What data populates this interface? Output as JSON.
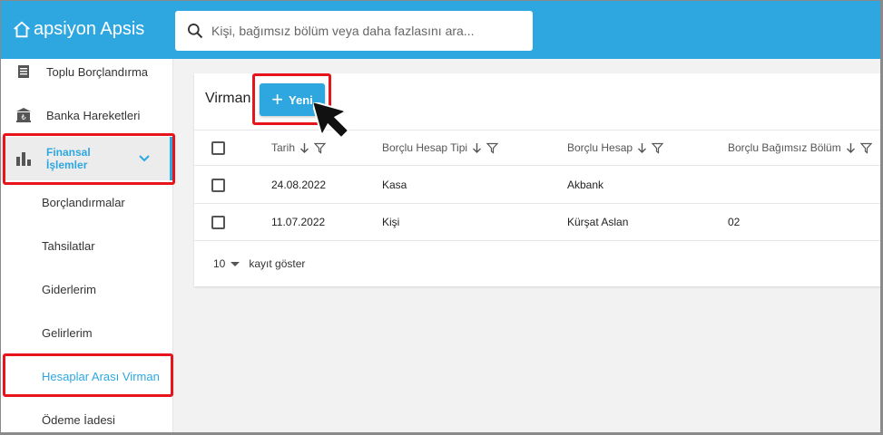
{
  "header": {
    "logo_text": "apsiyon Apsis",
    "search_placeholder": "Kişi, bağımsız bölüm veya daha fazlasını ara..."
  },
  "sidebar": {
    "items": [
      {
        "label": "Toplu Borçlandırma",
        "icon": "document-list-icon"
      },
      {
        "label": "Banka Hareketleri",
        "icon": "bank-icon"
      },
      {
        "label": "Finansal İşlemler",
        "icon": "bar-chart-icon",
        "expanded": true
      },
      {
        "label": "Borçlandırmalar"
      },
      {
        "label": "Tahsilatlar"
      },
      {
        "label": "Giderlerim"
      },
      {
        "label": "Gelirlerim"
      },
      {
        "label": "Hesaplar Arası Virman",
        "current": true
      },
      {
        "label": "Ödeme İadesi"
      }
    ]
  },
  "main": {
    "title": "Virman",
    "new_button_label": "Yeni",
    "columns": [
      "Tarih",
      "Borçlu Hesap Tipi",
      "Borçlu Hesap",
      "Borçlu Bağımsız Bölüm"
    ],
    "rows": [
      {
        "date": "24.08.2022",
        "account_type": "Kasa",
        "account": "Akbank",
        "unit": ""
      },
      {
        "date": "11.07.2022",
        "account_type": "Kişi",
        "account": "Kürşat Aslan",
        "unit": "02"
      }
    ],
    "page_size": "10",
    "page_size_label": "kayıt göster"
  },
  "colors": {
    "accent": "#2ea7e0",
    "highlight": "#e8141b"
  }
}
